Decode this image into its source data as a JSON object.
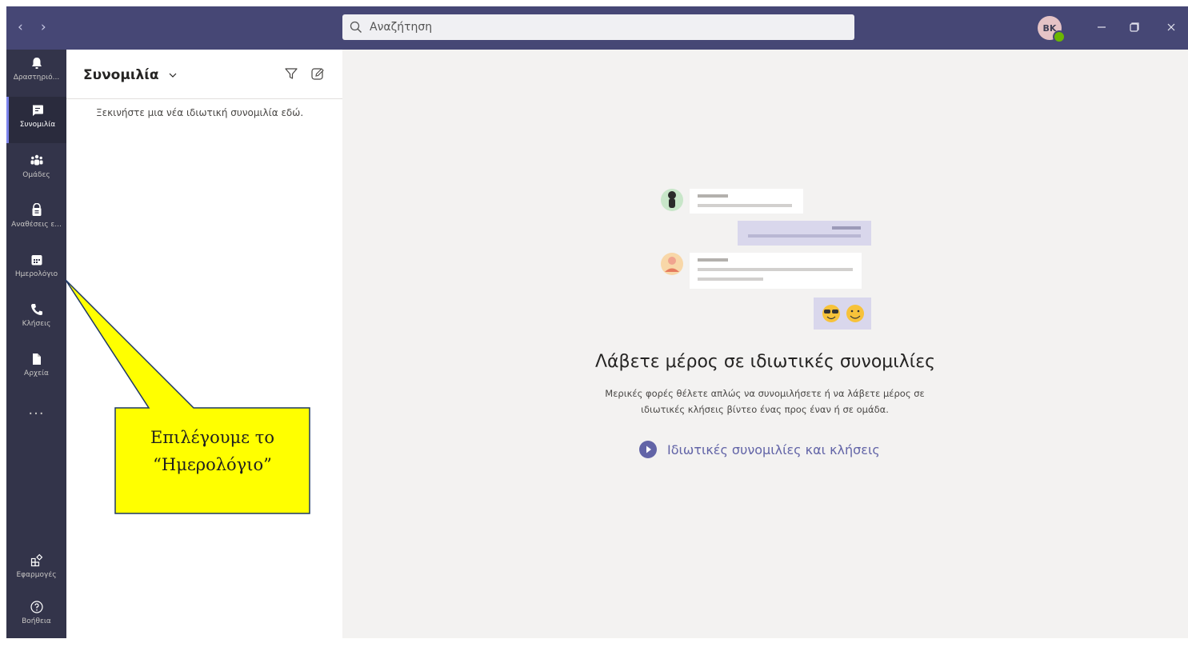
{
  "titlebar": {
    "search_placeholder": "Αναζήτηση",
    "avatar_initials": "BK",
    "back_icon": "chevron-left-icon",
    "forward_icon": "chevron-right-icon"
  },
  "rail": {
    "items": [
      {
        "label": "Δραστηριό...",
        "icon": "bell-icon"
      },
      {
        "label": "Συνομιλία",
        "icon": "chat-icon",
        "active": true
      },
      {
        "label": "Ομάδες",
        "icon": "teams-icon"
      },
      {
        "label": "Αναθέσεις ε...",
        "icon": "assignments-icon"
      },
      {
        "label": "Ημερολόγιο",
        "icon": "calendar-icon"
      },
      {
        "label": "Κλήσεις",
        "icon": "phone-icon"
      },
      {
        "label": "Αρχεία",
        "icon": "file-icon"
      },
      {
        "label": "Εφαρμογές",
        "icon": "apps-icon"
      },
      {
        "label": "Βοήθεια",
        "icon": "help-icon"
      }
    ],
    "more_label": "..."
  },
  "chatlist": {
    "title": "Συνομιλία",
    "empty_text": "Ξεκινήστε μια νέα ιδιωτική συνομιλία εδώ."
  },
  "main": {
    "title": "Λάβετε μέρος σε ιδιωτικές συνομιλίες",
    "desc_line1": "Μερικές φορές θέλετε απλώς να συνομιλήσετε ή να λάβετε μέρος σε",
    "desc_line2": "ιδιωτικές κλήσεις βίντεο ένας προς έναν ή σε ομάδα.",
    "link_label": "Ιδιωτικές συνομιλίες και κλήσεις"
  },
  "callout": {
    "line1": "Επιλέγουμε το",
    "line2": "“Ημερολόγιο”"
  },
  "colors": {
    "titlebar": "#464775",
    "rail": "#33344a",
    "accent": "#6264a7",
    "callout_fill": "#ffff00",
    "callout_border": "#1f3864"
  }
}
